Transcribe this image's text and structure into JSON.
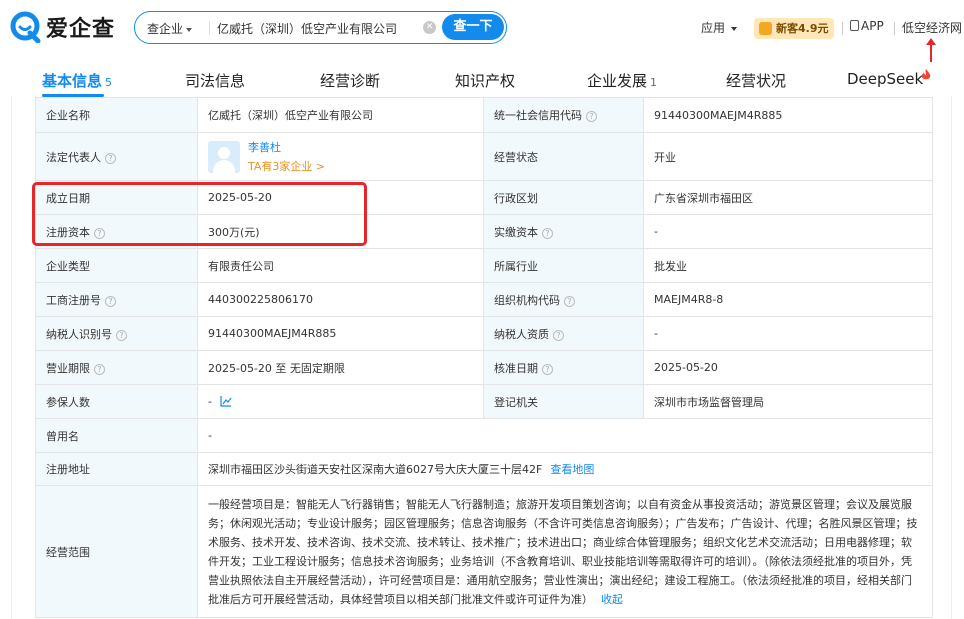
{
  "header": {
    "logo_text": "爱企查",
    "search_scope": "查企业",
    "search_value": "亿威托（深圳）低空产业有限公司",
    "search_button": "查一下",
    "apps_label": "应用",
    "promo_label": "新客4.9元",
    "app_label": "APP",
    "top_link": "低空经济网"
  },
  "tabs": [
    {
      "label": "基本信息",
      "count": "5",
      "active": true
    },
    {
      "label": "司法信息",
      "count": ""
    },
    {
      "label": "经营诊断",
      "count": ""
    },
    {
      "label": "知识产权",
      "count": ""
    },
    {
      "label": "企业发展",
      "count": "1"
    },
    {
      "label": "经营状况",
      "count": ""
    },
    {
      "label": "DeepSeek",
      "count": ""
    }
  ],
  "info": {
    "company_name_label": "企业名称",
    "company_name": "亿威托（深圳）低空产业有限公司",
    "credit_code_label": "统一社会信用代码",
    "credit_code": "91440300MAEJM4R885",
    "legal_rep_label": "法定代表人",
    "legal_rep_name": "李善杜",
    "legal_rep_sub": "TA有3家企业 >",
    "status_label": "经营状态",
    "status": "开业",
    "founded_label": "成立日期",
    "founded": "2025-05-20",
    "district_label": "行政区划",
    "district": "广东省深圳市福田区",
    "reg_capital_label": "注册资本",
    "reg_capital": "300万(元)",
    "paid_capital_label": "实缴资本",
    "paid_capital": "-",
    "type_label": "企业类型",
    "type": "有限责任公司",
    "industry_label": "所属行业",
    "industry": "批发业",
    "reg_no_label": "工商注册号",
    "reg_no": "440300225806170",
    "org_code_label": "组织机构代码",
    "org_code": "MAEJM4R8-8",
    "tax_id_label": "纳税人识别号",
    "tax_id": "91440300MAEJM4R885",
    "taxpayer_qual_label": "纳税人资质",
    "taxpayer_qual": "-",
    "term_label": "营业期限",
    "term": "2025-05-20 至 无固定期限",
    "approve_date_label": "核准日期",
    "approve_date": "2025-05-20",
    "insured_label": "参保人数",
    "insured": "-",
    "authority_label": "登记机关",
    "authority": "深圳市市场监督管理局",
    "former_name_label": "曾用名",
    "former_name": "-",
    "address_label": "注册地址",
    "address": "深圳市福田区沙头街道天安社区深南大道6027号大庆大厦三十层42F",
    "map_link": "查看地图",
    "scope_label": "经营范围",
    "scope": "一般经营项目是：智能无人飞行器销售；智能无人飞行器制造；旅游开发项目策划咨询；以自有资金从事投资活动；游览景区管理；会议及展览服务；休闲观光活动；专业设计服务；园区管理服务；信息咨询服务（不含许可类信息咨询服务）；广告发布；广告设计、代理；名胜风景区管理；技术服务、技术开发、技术咨询、技术交流、技术转让、技术推广；技术进出口；商业综合体管理服务；组织文化艺术交流活动；日用电器修理；软件开发；工业工程设计服务；信息技术咨询服务；业务培训（不含教育培训、职业技能培训等需取得许可的培训）。（除依法须经批准的项目外，凭营业执照依法自主开展经营活动），许可经营项目是：通用航空服务；营业性演出；演出经纪；建设工程施工。（依法须经批准的项目，经相关部门批准后方可开展经营活动，具体经营项目以相关部门批准文件或许可证件为准）",
    "collapse_link": "收起"
  },
  "colors": {
    "accent": "#128bed",
    "label_bg": "#f2f9fc",
    "highlight": "#e8262a",
    "orange": "#ee8e1f"
  }
}
